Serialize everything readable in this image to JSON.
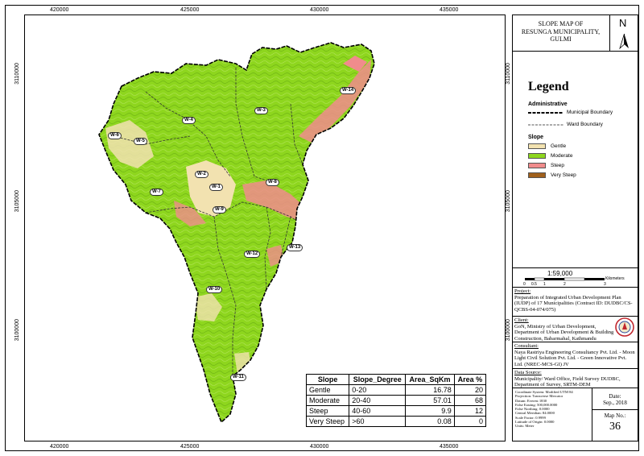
{
  "map": {
    "coords_x_top": [
      "420000",
      "425000",
      "430000",
      "435000"
    ],
    "coords_x_bottom": [
      "420000",
      "425000",
      "430000",
      "435000"
    ],
    "coords_y_left": [
      "3110000",
      "3105000",
      "3100000"
    ],
    "coords_y_right": [
      "3110000",
      "3105000",
      "3100000"
    ],
    "wards": [
      "W-1",
      "W-2",
      "W-3",
      "W-4",
      "W-5",
      "W-6",
      "W-7",
      "W-8",
      "W-9",
      "W-10",
      "W-11",
      "W-12",
      "W-13",
      "W-14"
    ],
    "colors": {
      "gentle": "#f2e2b0",
      "moderate": "#8ed61e",
      "steep": "#f08c8c",
      "very_steep": "#a0601c"
    }
  },
  "title": {
    "line1": "SLOPE MAP OF",
    "line2": "RESUNGA MUNICIPALITY,",
    "line3": "GULMI"
  },
  "north": {
    "letter": "N"
  },
  "legend": {
    "title": "Legend",
    "administrative": "Administrative",
    "municipal_boundary": "Municipal Boundary",
    "ward_boundary": "Ward Boundary",
    "slope": "Slope",
    "items": [
      "Gentle",
      "Moderate",
      "Steep",
      "Very Steep"
    ]
  },
  "scale": {
    "ratio": "1:59,000",
    "unit": "Kilometers",
    "ticks": [
      "0",
      "0.5",
      "1",
      "2",
      "3"
    ]
  },
  "project": {
    "label": "Project:",
    "text": "Preparation of Integrated Urban Development Plan (IUDP) of 17 Municipalities (Contract ID: DUDBC/CS-QCBS-04-074/075)"
  },
  "client": {
    "label": "Client:",
    "text": "GoN, Ministry of Urban Development, Department of Urban Development & Building Construction, Babarmahal, Kathmandu"
  },
  "consultant": {
    "label": "Consultant:",
    "text": "Naya Rastriya Engineering Consultancy Pvt. Ltd. - Moon Light Civil Solution Pvt. Ltd. - Green Innovative Pvt. Ltd. (NREC-MCS-GI) JV"
  },
  "data_source": {
    "label": "Data Source:",
    "text": "Municipality/ Ward Office, Field Survey DUDBC, Department of Survey, SRTM-DEM"
  },
  "projection": [
    "Coordinate System: Modified UTM 84",
    "Projection: Transverse Mercator",
    "Datum: Everest 1830",
    "False Easting: 500,000.0000",
    "False Northing: 0.0000",
    "Central Meridian: 84.0000",
    "Scale Factor: 0.9999",
    "Latitude of Origin: 0.0000",
    "Units: Meter"
  ],
  "date": {
    "label": "Date:",
    "value": "Sep., 2018"
  },
  "map_no": {
    "label": "Map No.:",
    "value": "36"
  },
  "table": {
    "headers": [
      "Slope",
      "Slope_Degree",
      "Area_SqKm",
      "Area %"
    ],
    "rows": [
      [
        "Gentle",
        "0-20",
        "16.78",
        "20"
      ],
      [
        "Moderate",
        "20-40",
        "57.01",
        "68"
      ],
      [
        "Steep",
        "40-60",
        "9.9",
        "12"
      ],
      [
        "Very Steep",
        ">60",
        "0.08",
        "0"
      ]
    ]
  }
}
